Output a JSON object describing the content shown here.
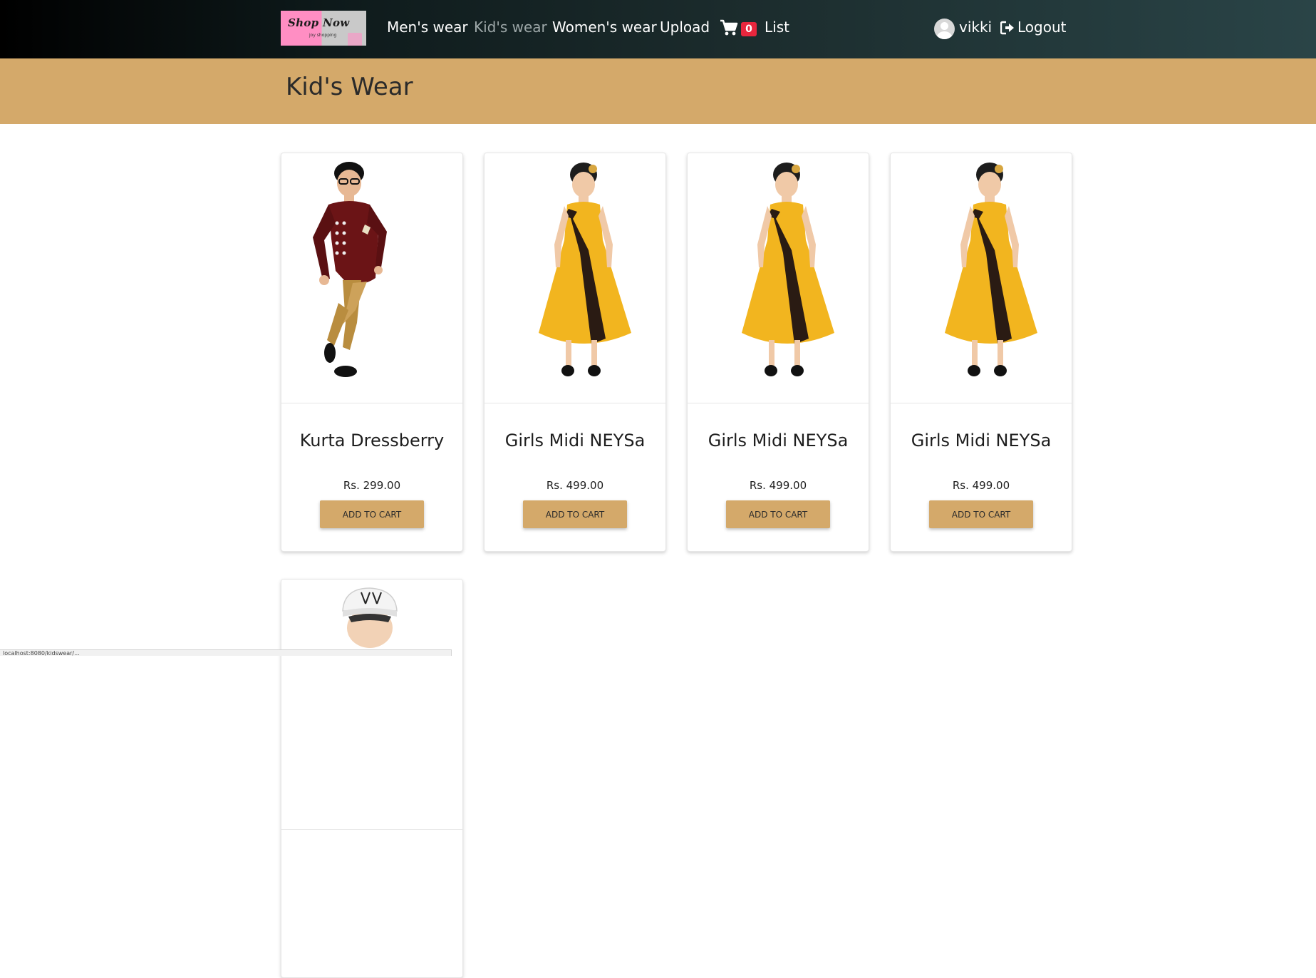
{
  "navbar": {
    "logo_text": "Shop Now",
    "logo_subtext": "joy shopping",
    "links": [
      "Men's wear",
      "Kid's wear",
      "Women's wear",
      "Upload",
      "List"
    ],
    "active_link": "Kid's wear",
    "cart_count": "0",
    "username": "vikki",
    "logout_label": "Logout"
  },
  "page": {
    "title": "Kid's Wear"
  },
  "products": [
    {
      "name": "Kurta Dressberry",
      "price": "Rs. 299.00",
      "button": "ADD TO CART",
      "image": "boy-kurta-image"
    },
    {
      "name": "Girls Midi NEYSa",
      "price": "Rs. 499.00",
      "button": "ADD TO CART",
      "image": "girl-yellow-dress-image"
    },
    {
      "name": "Girls Midi NEYSa",
      "price": "Rs. 499.00",
      "button": "ADD TO CART",
      "image": "girl-yellow-dress-image"
    },
    {
      "name": "Girls Midi NEYSa",
      "price": "Rs. 499.00",
      "button": "ADD TO CART",
      "image": "girl-yellow-dress-image"
    },
    {
      "image": "boy-cap-image"
    }
  ],
  "status_bar": {
    "url": "localhost:8080/kidswear/..."
  },
  "colors": {
    "banner": "#d4a96a",
    "button": "#d4a96a",
    "badge": "#e8263d",
    "dress_yellow": "#f2b51f",
    "kurta_maroon": "#6b1416"
  }
}
